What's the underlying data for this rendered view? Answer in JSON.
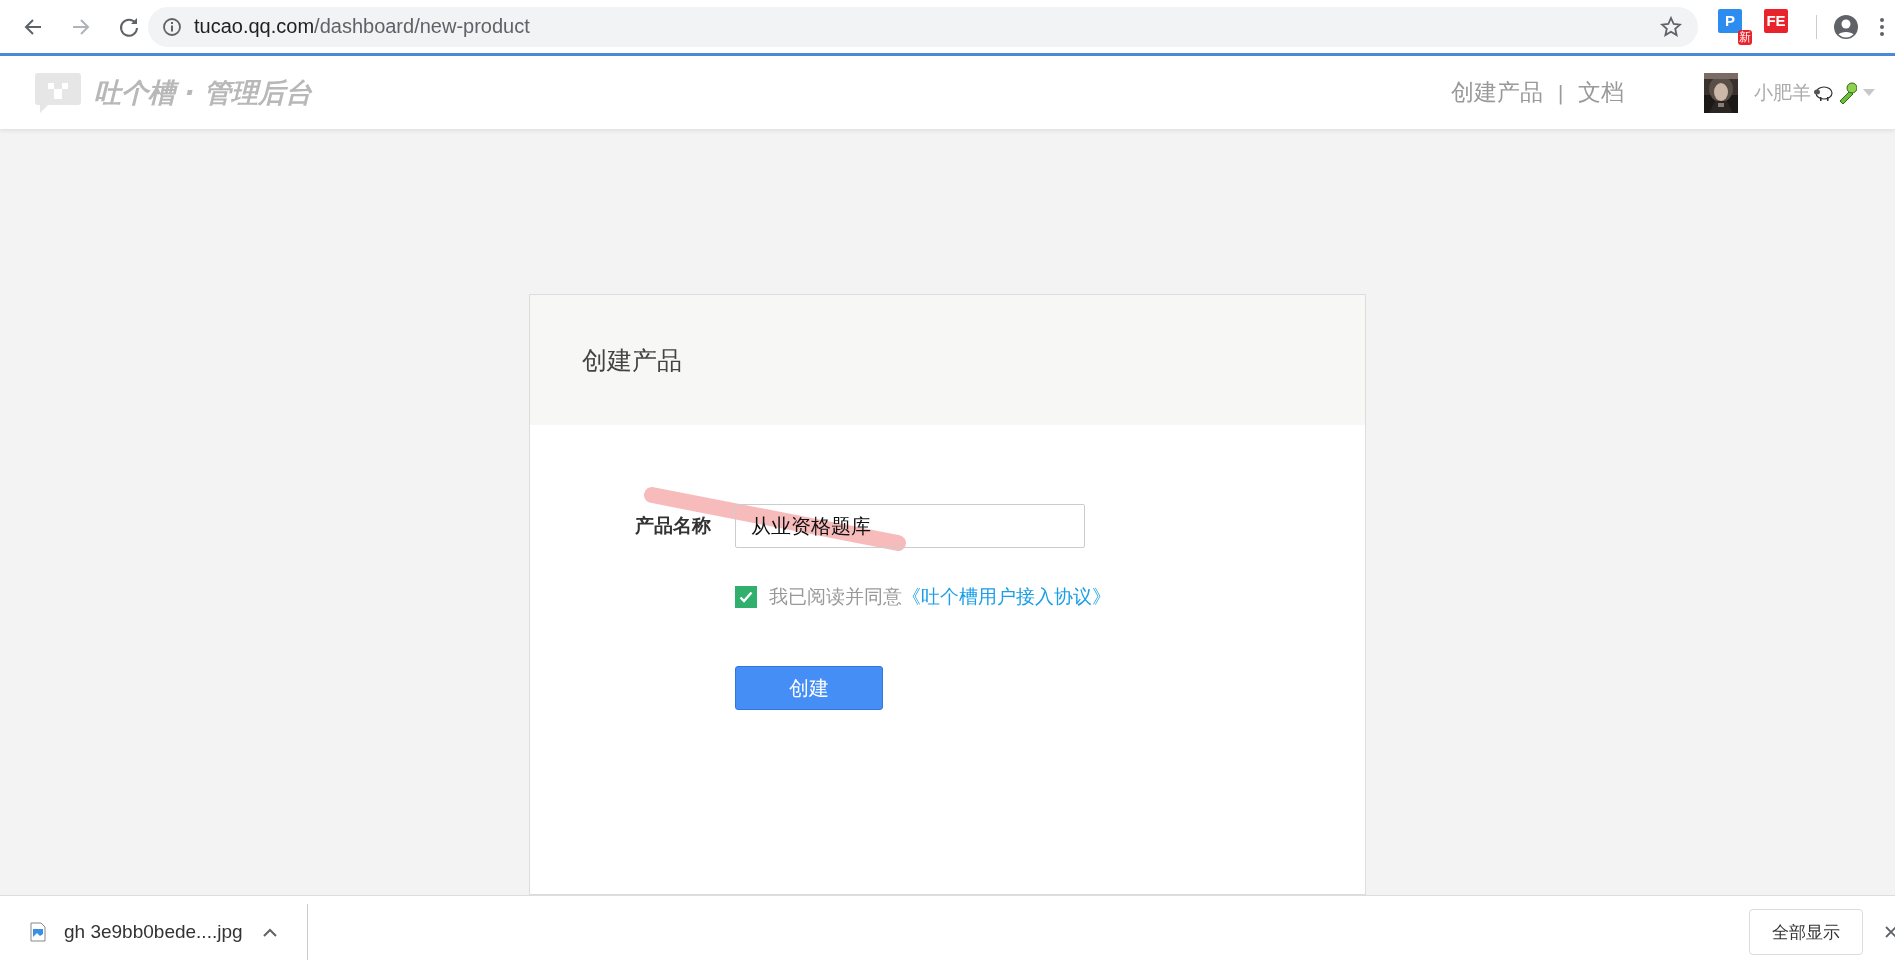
{
  "browser": {
    "url_host": "tucao.qq.com",
    "url_path": "/dashboard/new-product",
    "extensions": [
      {
        "label": "P",
        "badge": "新",
        "color": "#2d8cf0"
      },
      {
        "label": "FE",
        "color": "#e8232b"
      }
    ]
  },
  "header": {
    "logo": "吐个槽 · 管理后台",
    "nav": [
      {
        "label": "创建产品"
      },
      {
        "label": "文档"
      }
    ],
    "nav_separator": "|",
    "user": {
      "name": "小肥羊"
    }
  },
  "card": {
    "title": "创建产品",
    "field": {
      "label": "产品名称",
      "value": "从业资格题库"
    },
    "agreement": {
      "checked": true,
      "text": "我已阅读并同意",
      "link": "《吐个槽用户接入协议》"
    },
    "submit": "创建"
  },
  "downloads": {
    "file": "gh 3e9bb0bede....jpg",
    "show_all": "全部显示"
  }
}
